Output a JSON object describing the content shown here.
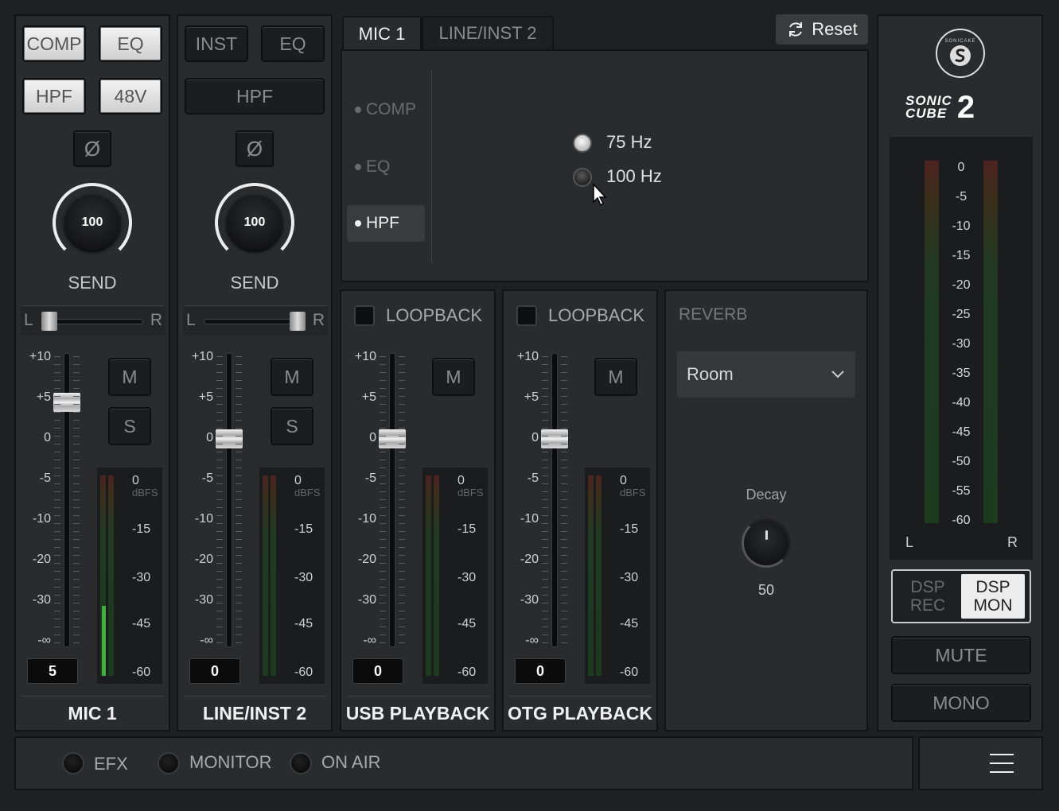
{
  "channels": [
    {
      "name": "MIC 1",
      "buttons": [
        "COMP",
        "EQ",
        "HPF",
        "48V"
      ],
      "send_value": "100",
      "send_label": "SEND",
      "pan_left": "L",
      "pan_right": "R",
      "fader_value": "5",
      "mute": "M",
      "solo": "S"
    },
    {
      "name": "LINE/INST 2",
      "buttons": [
        "INST",
        "EQ",
        "HPF"
      ],
      "send_value": "100",
      "send_label": "SEND",
      "pan_left": "L",
      "pan_right": "R",
      "fader_value": "0",
      "mute": "M",
      "solo": "S"
    },
    {
      "name": "USB PLAYBACK",
      "loopback": "LOOPBACK",
      "fader_value": "0",
      "mute": "M"
    },
    {
      "name": "OTG PLAYBACK",
      "loopback": "LOOPBACK",
      "fader_value": "0",
      "mute": "M"
    }
  ],
  "phase_symbol": "Ø",
  "fader_scale": [
    "+10",
    "+5",
    "0",
    "-5",
    "-10",
    "-20",
    "-30",
    "-∞"
  ],
  "meter_scale": [
    "0",
    "-15",
    "-30",
    "-45",
    "-60"
  ],
  "meter_unit": "dBFS",
  "tabs": [
    "MIC 1",
    "LINE/INST 2"
  ],
  "reset_label": "Reset",
  "dsp_menu": [
    "COMP",
    "EQ",
    "HPF"
  ],
  "hpf_options": [
    "75 Hz",
    "100 Hz"
  ],
  "reverb": {
    "title": "REVERB",
    "preset": "Room",
    "decay_label": "Decay",
    "decay_value": "50"
  },
  "master": {
    "brand_line1": "SONIC",
    "brand_line2": "CUBE",
    "brand_number": "2",
    "logo_text": "SONICAKE",
    "scale": [
      "0",
      "-5",
      "-10",
      "-15",
      "-20",
      "-25",
      "-30",
      "-35",
      "-40",
      "-45",
      "-50",
      "-55",
      "-60"
    ],
    "left": "L",
    "right": "R",
    "dsp_rec": [
      "DSP",
      "REC"
    ],
    "dsp_mon": [
      "DSP",
      "MON"
    ],
    "mute": "MUTE",
    "mono": "MONO"
  },
  "footer": {
    "efx": "EFX",
    "monitor": "MONITOR",
    "on_air": "ON AIR"
  },
  "colors": {
    "background": "#1f2022",
    "panel": "#2a2b2d",
    "meter_green": "#3fae3f",
    "lit_button": "#e8e8e8"
  }
}
